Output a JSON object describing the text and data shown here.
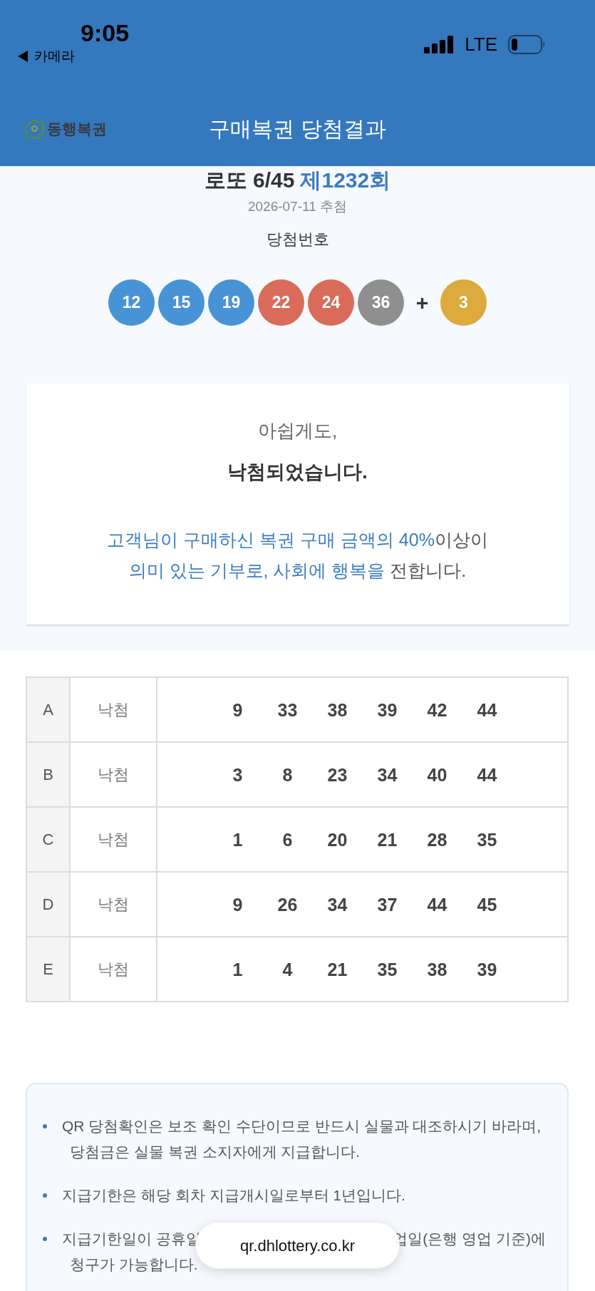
{
  "status_bar": {
    "time": "9:05",
    "back_label": "카메라",
    "network": "LTE"
  },
  "header": {
    "logo": "동행복권",
    "title": "구매복권 당첨결과"
  },
  "draw": {
    "game": "로또 6/45",
    "round": "제1232회",
    "date": "2026-07-11 추첨",
    "numbers_label": "당첨번호",
    "balls": [
      {
        "number": "12",
        "color": "#4893d6"
      },
      {
        "number": "15",
        "color": "#4893d6"
      },
      {
        "number": "19",
        "color": "#4893d6"
      },
      {
        "number": "22",
        "color": "#d96b5b"
      },
      {
        "number": "24",
        "color": "#d96b5b"
      },
      {
        "number": "36",
        "color": "#8f8f8f"
      }
    ],
    "plus": "+",
    "bonus_ball": {
      "number": "3",
      "color": "#dcaa3d"
    }
  },
  "result_card": {
    "intro": "아쉽게도,",
    "result": "낙첨되었습니다.",
    "message_lines": [
      {
        "segments": [
          {
            "text": "고객님이 구매하신 복권 구매 금액의 40%",
            "highlight": true
          },
          {
            "text": "이상이",
            "highlight": false
          }
        ]
      },
      {
        "segments": [
          {
            "text": "의미 있는 기부로, 사회에 행복을",
            "highlight": true
          },
          {
            "text": " 전합니다.",
            "highlight": false
          }
        ]
      }
    ]
  },
  "games": [
    {
      "label": "A",
      "result": "낙첨",
      "numbers": [
        "9",
        "33",
        "38",
        "39",
        "42",
        "44"
      ]
    },
    {
      "label": "B",
      "result": "낙첨",
      "numbers": [
        "3",
        "8",
        "23",
        "34",
        "40",
        "44"
      ]
    },
    {
      "label": "C",
      "result": "낙첨",
      "numbers": [
        "1",
        "6",
        "20",
        "21",
        "28",
        "35"
      ]
    },
    {
      "label": "D",
      "result": "낙첨",
      "numbers": [
        "9",
        "26",
        "34",
        "37",
        "44",
        "45"
      ]
    },
    {
      "label": "E",
      "result": "낙첨",
      "numbers": [
        "1",
        "4",
        "21",
        "35",
        "38",
        "39"
      ]
    }
  ],
  "notes": [
    {
      "lines": [
        [
          "QR 당첨확인은 보조 확인 수단이므로 반드시 실물과 대조하시기 바라며,"
        ],
        [
          "당첨금은 실물 복권 소지자에게 지급합니다."
        ]
      ]
    },
    {
      "lines": [
        [
          "지급기한은 해당 회차 지급개시일로부터 1년입니다."
        ]
      ]
    },
    {
      "lines": [
        [
          "지급기한일이 공휴일",
          "업일(은행 영업 기준)에"
        ],
        [
          "청구가 가능합니다."
        ]
      ]
    }
  ],
  "browser": {
    "url": "qr.dhlottery.co.kr"
  }
}
